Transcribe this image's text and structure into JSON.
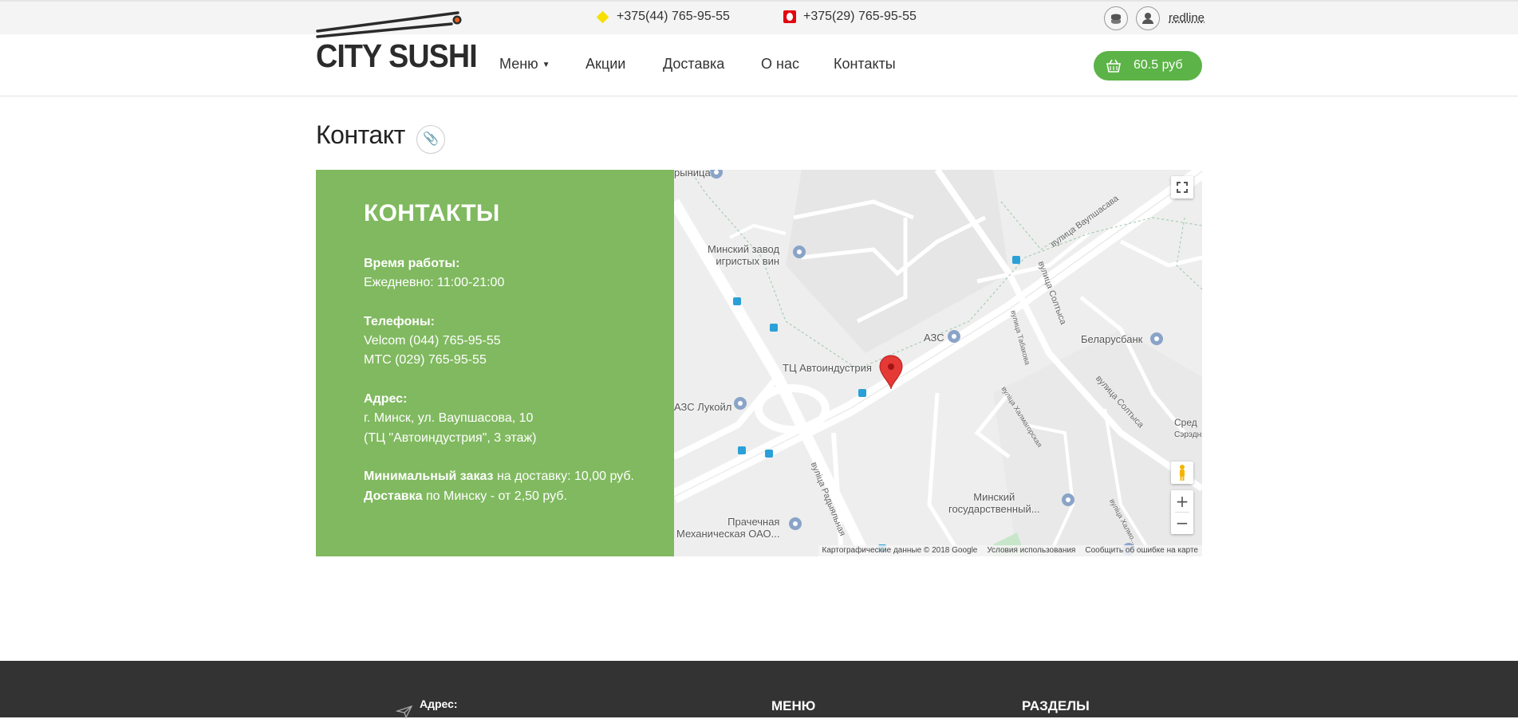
{
  "topbar": {
    "phones": [
      {
        "number": "+375(44) 765-95-55",
        "operator_icon": "velcom-diamond-icon",
        "color": "#f7e000"
      },
      {
        "number": "+375(29) 765-95-55",
        "operator_icon": "mts-egg-icon",
        "color": "#e30611"
      }
    ],
    "icons": [
      "sushi-bowl-icon",
      "user-icon"
    ],
    "user": "redline"
  },
  "header": {
    "logo_text": "CITY SUSHI",
    "nav": [
      {
        "label": "Меню"
      },
      {
        "label": "Акции"
      },
      {
        "label": "Доставка"
      },
      {
        "label": "О нас"
      },
      {
        "label": "Контакты"
      }
    ],
    "cart": {
      "total": "60.5 руб",
      "icon": "basket-icon",
      "color": "#5cb347"
    }
  },
  "page": {
    "title": "Контакт",
    "link_icon": "paperclip-icon"
  },
  "contacts": {
    "heading": "КОНТАКТЫ",
    "panel_color": "#80b95f",
    "hours_label": "Время работы:",
    "hours": "Ежедневно: 11:00-21:00",
    "phones_label": "Телефоны:",
    "phone_velcom": "Velcom (044) 765-95-55",
    "phone_mts": "МТС (029) 765-95-55",
    "address_label": "Адрес:",
    "address_line1": "г. Минск, ул. Ваупшасова, 10",
    "address_line2": "(ТЦ \"Автоиндустрия\", 3 этаж)",
    "min_order_bold": "Минимальный заказ",
    "min_order_rest": " на доставку: 10,00 руб.",
    "delivery_bold": "Доставка",
    "delivery_rest": " по Минску - от 2,50 руб."
  },
  "map": {
    "places": {
      "winery_1": "Минский завод",
      "winery_2": "игристых вин",
      "gas_station": "АЗС",
      "belarusbank": "Беларусбанк",
      "mall": "ТЦ Автоиндустрия",
      "lukoil": "АЗС Лукойл",
      "state_1": "Минский",
      "state_2": "государственный...",
      "laundry_1": "Прачечная",
      "laundry_2": "Механическая ОАО...",
      "top_left": "рыница",
      "sred_1": "Сред",
      "sred_2": "Сэрэдняя"
    },
    "streets": {
      "vaupshasova": "вулица Ваупшасава",
      "soltysa_1": "вулица Солтыса",
      "soltysa_2": "вулица Солтыса",
      "tabakovaya": "вулица Табакова",
      "halmagorskaya": "вуліца Халмагорская",
      "radyalnaya": "вуліца Радыяльная",
      "halmogorskaya_2": "вуліца Халмо..."
    },
    "zoom_in": "+",
    "zoom_out": "−",
    "attribution": [
      "Картографические данные © 2018 Google",
      "Условия использования",
      "Сообщить об ошибке на карте"
    ],
    "marker_color": "#e53935"
  },
  "footer": {
    "address_label": "Адрес:",
    "menu_heading": "МЕНЮ",
    "sections_heading": "РАЗДЕЛЫ"
  }
}
